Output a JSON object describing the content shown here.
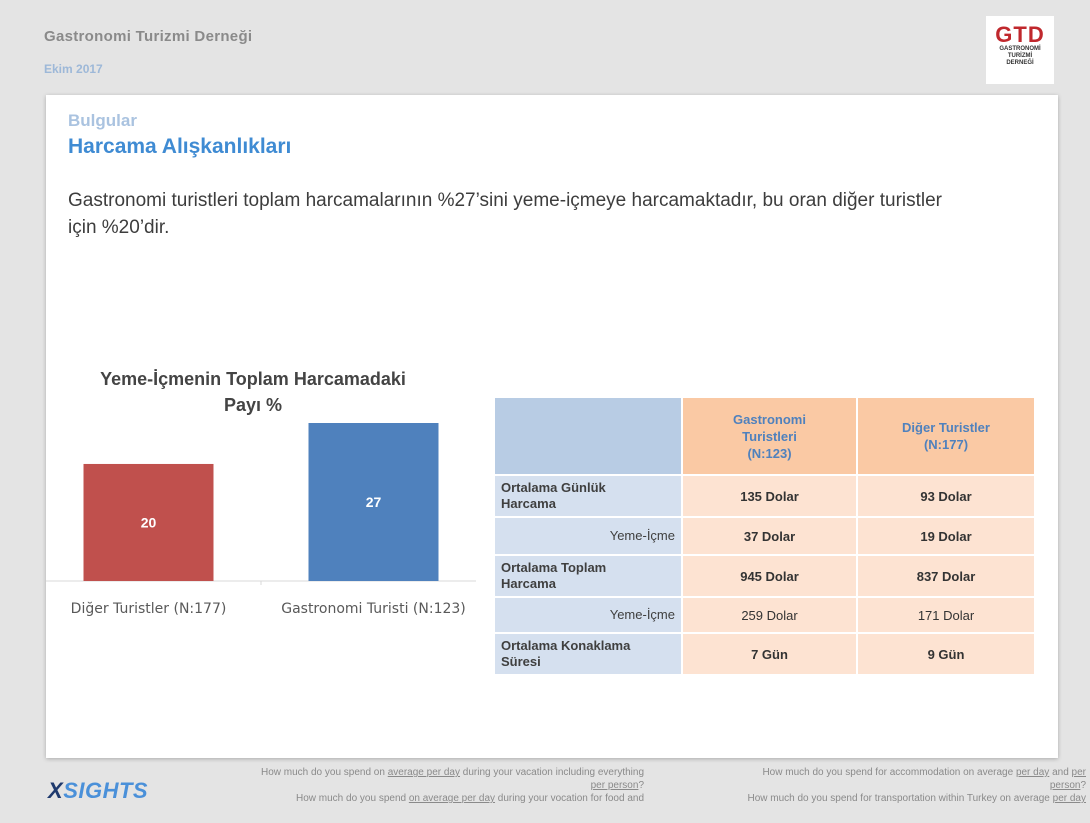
{
  "header": {
    "org": "Gastronomi  Turizmi  Derneği",
    "date": "Ekim 2017",
    "logo_main": "GTD",
    "logo_sub": [
      "GASTRONOMİ",
      "TURİZMİ",
      "DERNEĞİ"
    ]
  },
  "slide": {
    "section": "Bulgular",
    "title": "Harcama Alışkanlıkları",
    "intro": "Gastronomi turistleri toplam harcamalarının %27’sini yeme-içmeye harcamaktadır, bu oran diğer turistler için %20’dir."
  },
  "chart_data": {
    "type": "bar",
    "title_lines": [
      "Yeme-İçmenin Toplam Harcamadaki",
      "Payı %"
    ],
    "categories": [
      "Diğer Turistler (N:177)",
      "Gastronomi Turisti (N:123)"
    ],
    "values": [
      20,
      27
    ],
    "bar_colors": [
      "#c0504d",
      "#4f81bd"
    ],
    "label_color": "#ffffff",
    "ylim": [
      0,
      27
    ],
    "grid": false,
    "legend": "none"
  },
  "table": {
    "columns": [
      [
        "Gastronomi",
        "Turistleri",
        "(N:123)"
      ],
      [
        "Diğer Turistler",
        "(N:177)"
      ]
    ],
    "rows": [
      {
        "label": [
          "Ortalama Günlük",
          "Harcama"
        ],
        "sub": false,
        "values": [
          "135 Dolar",
          "93 Dolar"
        ]
      },
      {
        "label": [
          "Yeme-İçme"
        ],
        "sub": true,
        "values": [
          "37 Dolar",
          "19 Dolar"
        ]
      },
      {
        "label": [
          "Ortalama Toplam",
          "Harcama"
        ],
        "sub": false,
        "values": [
          "945 Dolar",
          "837 Dolar"
        ]
      },
      {
        "label": [
          "Yeme-İçme"
        ],
        "sub": true,
        "values": [
          "259 Dolar",
          "171 Dolar"
        ]
      },
      {
        "label": [
          "Ortalama Konaklama",
          "Süresi"
        ],
        "sub": false,
        "values": [
          "7 Gün",
          "9 Gün"
        ]
      }
    ]
  },
  "footer": {
    "brand_x": "X",
    "brand_rest": "SIGHTS",
    "notes": [
      {
        "a": "How much do you spend on ",
        "u": "average per day",
        "b": " during your vacation including everything",
        "c": "per person",
        "d": "?"
      },
      {
        "a": "How much do you spend ",
        "u": "on average per day",
        "b": " during your vocation for food and",
        "c": "",
        "d": ""
      },
      {
        "a": "How much do you spend for accommodation  on average ",
        "u": "per day",
        "b": " and ",
        "c": "per",
        "d": ""
      },
      {
        "a": "",
        "u": "",
        "b": "",
        "c": "person",
        "d": "?"
      },
      {
        "a": "How much do you spend for transportation within Turkey on average ",
        "u": "per day",
        "b": "",
        "c": "",
        "d": ""
      }
    ]
  }
}
